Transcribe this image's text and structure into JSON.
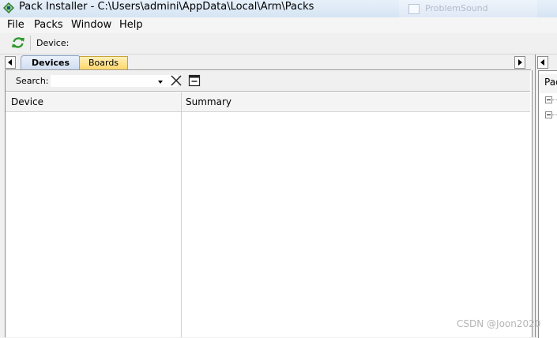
{
  "window": {
    "title": "Pack Installer - C:\\Users\\admini\\AppData\\Local\\Arm\\Packs",
    "background_window_text": "ProblemSound"
  },
  "menu": [
    "File",
    "Packs",
    "Window",
    "Help"
  ],
  "toolbar": {
    "device_label": "Device:"
  },
  "left_tabs": {
    "devices": "Devices",
    "boards": "Boards"
  },
  "search": {
    "label": "Search:",
    "value": "",
    "placeholder": ""
  },
  "table": {
    "columns": [
      "Device",
      "Summary"
    ],
    "rows": []
  },
  "right_pane": {
    "header": "Pac"
  },
  "watermark": "CSDN @Joon2020",
  "colors": {
    "boards_tab": "#ffd76b",
    "devices_tab": "#cfdcf0",
    "refresh_icon": "#2e9a2e"
  }
}
